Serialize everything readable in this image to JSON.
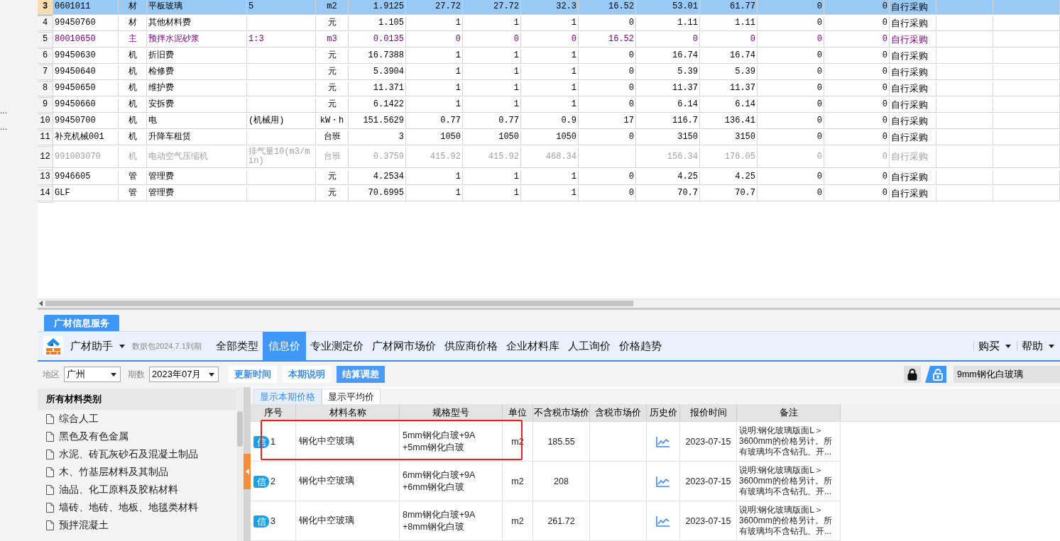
{
  "left_strip": {
    "labels": [
      "...",
      "..."
    ]
  },
  "grid": {
    "rows": [
      {
        "no": "3",
        "selected": true,
        "kind": "normal",
        "cells": [
          "0601011",
          "材",
          "平板玻璃",
          "5",
          "m2",
          "1.9125",
          "27.72",
          "27.72",
          "32.3",
          "16.52",
          "53.01",
          "61.77",
          "0",
          "0",
          "自行采购"
        ]
      },
      {
        "no": "4",
        "selected": false,
        "kind": "normal",
        "cells": [
          "99450760",
          "材",
          "其他材料费",
          null,
          "元",
          "1.105",
          "1",
          "1",
          "1",
          "0",
          "1.11",
          "1.11",
          "0",
          "0",
          "自行采购"
        ]
      },
      {
        "no": "5",
        "selected": false,
        "kind": "main",
        "cells": [
          "80010650",
          "主",
          "预拌水泥砂浆",
          "1:3",
          "m3",
          "0.0135",
          "0",
          "0",
          "0",
          "16.52",
          "0",
          "0",
          "0",
          "0",
          "自行采购"
        ]
      },
      {
        "no": "6",
        "selected": false,
        "kind": "normal",
        "cells": [
          "99450630",
          "机",
          "折旧费",
          null,
          "元",
          "16.7388",
          "1",
          "1",
          "1",
          "0",
          "16.74",
          "16.74",
          "0",
          "0",
          "自行采购"
        ]
      },
      {
        "no": "7",
        "selected": false,
        "kind": "normal",
        "cells": [
          "99450640",
          "机",
          "检修费",
          null,
          "元",
          "5.3904",
          "1",
          "1",
          "1",
          "0",
          "5.39",
          "5.39",
          "0",
          "0",
          "自行采购"
        ]
      },
      {
        "no": "8",
        "selected": false,
        "kind": "normal",
        "cells": [
          "99450650",
          "机",
          "维护费",
          null,
          "元",
          "11.371",
          "1",
          "1",
          "1",
          "0",
          "11.37",
          "11.37",
          "0",
          "0",
          "自行采购"
        ]
      },
      {
        "no": "9",
        "selected": false,
        "kind": "normal",
        "cells": [
          "99450660",
          "机",
          "安拆费",
          null,
          "元",
          "6.1422",
          "1",
          "1",
          "1",
          "0",
          "6.14",
          "6.14",
          "0",
          "0",
          "自行采购"
        ]
      },
      {
        "no": "10",
        "selected": false,
        "kind": "normal",
        "cells": [
          "99450700",
          "机",
          "电",
          "(机械用)",
          "kW・h",
          "151.5629",
          "0.77",
          "0.77",
          "0.9",
          "17",
          "116.7",
          "136.41",
          "0",
          "0",
          "自行采购"
        ]
      },
      {
        "no": "11",
        "selected": false,
        "kind": "normal",
        "cells": [
          "补充机械001",
          "机",
          "升降车租赁",
          null,
          "台班",
          "3",
          "1050",
          "1050",
          "1050",
          "0",
          "3150",
          "3150",
          "0",
          "0",
          "自行采购"
        ]
      },
      {
        "no": "12",
        "selected": false,
        "kind": "inactive",
        "cells": [
          "991003070",
          "机",
          "电动空气压缩机",
          "排气量10(m3/min)",
          "台班",
          "0.3759",
          "415.92",
          "415.92",
          "468.34",
          null,
          "156.34",
          "176.05",
          "0",
          "0",
          "自行采购"
        ]
      },
      {
        "no": "13",
        "selected": false,
        "kind": "normal",
        "cells": [
          "9946605",
          "管",
          "管理费",
          null,
          "元",
          "4.2534",
          "1",
          "1",
          "1",
          "0",
          "4.25",
          "4.25",
          "0",
          "0",
          "自行采购"
        ]
      },
      {
        "no": "14",
        "selected": false,
        "kind": "normal",
        "cells": [
          "GLF",
          "管",
          "管理费",
          null,
          "元",
          "70.6995",
          "1",
          "1",
          "1",
          "0",
          "70.7",
          "70.7",
          "0",
          "0",
          "自行采购"
        ]
      }
    ]
  },
  "panel": {
    "tab": "广材信息服务",
    "app_name": "广材助手",
    "package_note": "数据包2024.7.1到期",
    "menu": [
      {
        "label": "全部类型",
        "selected": false
      },
      {
        "label": "信息价",
        "selected": true
      },
      {
        "label": "专业测定价",
        "selected": false
      },
      {
        "label": "广材网市场价",
        "selected": false
      },
      {
        "label": "供应商价格",
        "selected": false
      },
      {
        "label": "企业材料库",
        "selected": false
      },
      {
        "label": "人工询价",
        "selected": false
      },
      {
        "label": "价格趋势",
        "selected": false
      }
    ],
    "right_menu": [
      "购买",
      "帮助"
    ],
    "filters": {
      "region_label": "地区",
      "region": "广州",
      "period_label": "期数",
      "period": "2023年07月"
    },
    "buttons": [
      {
        "label": "更新时间",
        "primary": false
      },
      {
        "label": "本期说明",
        "primary": false
      },
      {
        "label": "结算调差",
        "primary": true
      }
    ],
    "lock_modes": [
      {
        "kind": "locked",
        "selected": false
      },
      {
        "kind": "unlocked",
        "selected": true
      }
    ],
    "search": {
      "value": "9mm钢化白玻璃"
    },
    "categories": {
      "title": "所有材料类别",
      "items": [
        "综合人工",
        "黑色及有色金属",
        "水泥、砖瓦灰砂石及混凝土制品",
        "木、竹基层材料及其制品",
        "油品、化工原料及胶粘材料",
        "墙砖、地砖、地板、地毯类材料",
        "预拌混凝土"
      ]
    },
    "price_tabs": [
      {
        "label": "显示本期价格",
        "selected": true
      },
      {
        "label": "显示平均价",
        "selected": false
      }
    ],
    "price_table": {
      "columns": [
        "序号",
        "材料名称",
        "规格型号",
        "单位",
        "不含税市场价",
        "含税市场价",
        "历史价",
        "报价时间",
        "备注"
      ],
      "rows": [
        {
          "badge": "信",
          "no": "1",
          "name": "钢化中空玻璃",
          "spec": [
            "5mm钢化白玻+9A",
            "+5mm钢化白玻"
          ],
          "unit": "m2",
          "price": "185.55",
          "date": "2023-07-15",
          "remark": "说明:钢化玻璃版面L＞3600mm的价格另计。所有玻璃均不含钻孔、开...",
          "highlighted": true
        },
        {
          "badge": "信",
          "no": "2",
          "name": "钢化中空玻璃",
          "spec": [
            "6mm钢化白玻+9A",
            "+6mm钢化白玻"
          ],
          "unit": "m2",
          "price": "208",
          "date": "2023-07-15",
          "remark": "说明:钢化玻璃版面L＞3600mm的价格另计。所有玻璃均不含钻孔、开...",
          "highlighted": false
        },
        {
          "badge": "信",
          "no": "3",
          "name": "钢化中空玻璃",
          "spec": [
            "8mm钢化白玻+9A",
            "+8mm钢化白玻"
          ],
          "unit": "m2",
          "price": "261.72",
          "date": "2023-07-15",
          "remark": "说明:钢化玻璃版面L＞3600mm的价格另计。所有玻璃均不含钻孔、开...",
          "highlighted": false
        }
      ]
    }
  }
}
